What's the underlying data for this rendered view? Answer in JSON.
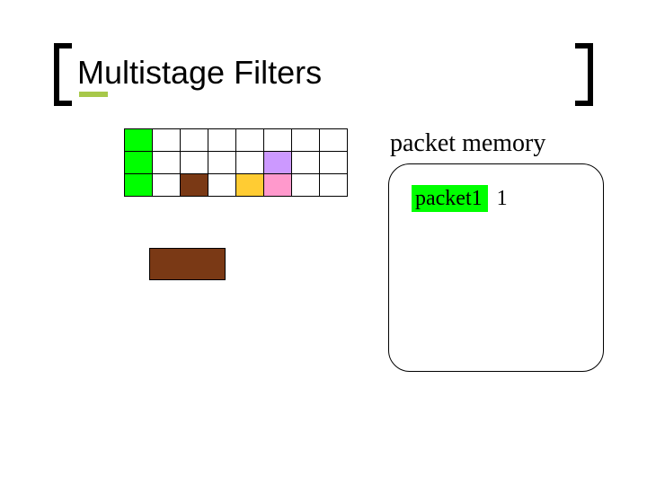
{
  "title": "Multistage Filters",
  "memory_label": "packet memory",
  "packet_entry": {
    "name": "packet1",
    "count": "1"
  },
  "colors": {
    "green": "#00ff00",
    "brown": "#7a3915",
    "orange": "#ffcc33",
    "purple": "#cc99ff",
    "pink": "#ff99cc",
    "empty": "#ffffff"
  },
  "filter_grid": {
    "rows": 3,
    "cols": 8,
    "cells": [
      [
        "green",
        "empty",
        "empty",
        "empty",
        "empty",
        "empty",
        "empty",
        "empty"
      ],
      [
        "green",
        "empty",
        "empty",
        "empty",
        "empty",
        "purple",
        "empty",
        "empty"
      ],
      [
        "green",
        "empty",
        "brown",
        "empty",
        "orange",
        "pink",
        "empty",
        "empty"
      ]
    ]
  },
  "slide_index": ""
}
